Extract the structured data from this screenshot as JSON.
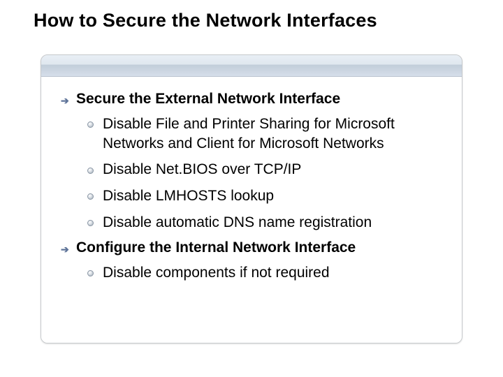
{
  "title": "How to Secure the Network Interfaces",
  "sections": [
    {
      "heading": "Secure the External Network Interface",
      "items": [
        "Disable File and Printer Sharing for Microsoft Networks and Client for Microsoft Networks",
        "Disable Net.BIOS over TCP/IP",
        "Disable LMHOSTS lookup",
        "Disable automatic DNS name registration"
      ]
    },
    {
      "heading": "Configure the Internal Network Interface",
      "items": [
        "Disable components if not required"
      ]
    }
  ]
}
